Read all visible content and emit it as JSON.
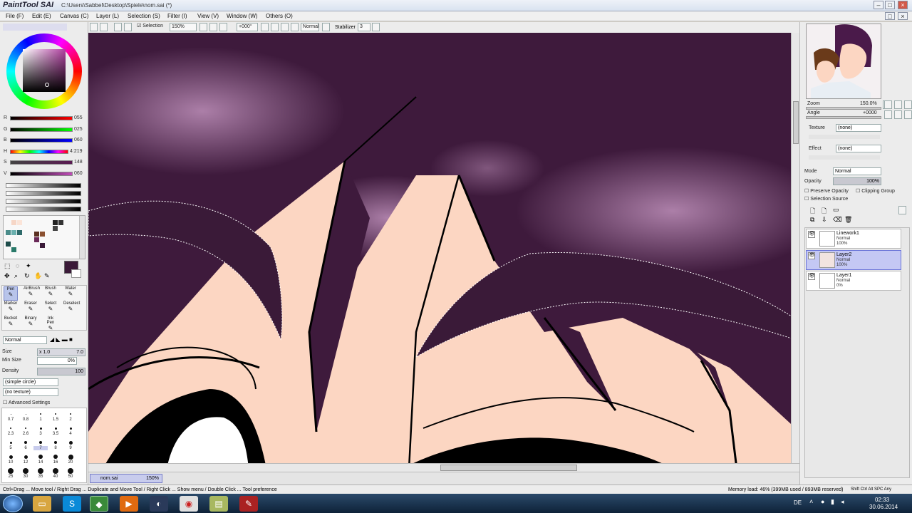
{
  "app": {
    "logo": "PaintTool SAI",
    "title_path": "C:\\Users\\Sabbel\\Desktop\\Spiele\\nom.sai (*)"
  },
  "menu": [
    "File (F)",
    "Edit (E)",
    "Canvas (C)",
    "Layer (L)",
    "Selection (S)",
    "Filter (I)",
    "View (V)",
    "Window (W)",
    "Others (O)"
  ],
  "toolbar": {
    "selection_label": "Selection",
    "zoom": "150%",
    "rotation": "+000°",
    "blend": "Normal",
    "stabilizer_label": "Stabilizer",
    "stabilizer_value": "3"
  },
  "color": {
    "current": "#3a1a38",
    "sliders": [
      {
        "label": "R",
        "value": "055"
      },
      {
        "label": "G",
        "value": "025"
      },
      {
        "label": "B",
        "value": "060"
      },
      {
        "label": "H",
        "value": "4:219"
      },
      {
        "label": "S",
        "value": "148"
      },
      {
        "label": "V",
        "value": "060"
      }
    ]
  },
  "tools": [
    {
      "label": "Pen",
      "selected": true
    },
    {
      "label": "AirBrush",
      "selected": false
    },
    {
      "label": "Brush",
      "selected": false
    },
    {
      "label": "Water",
      "selected": false
    },
    {
      "label": "Marker",
      "selected": false
    },
    {
      "label": "Eraser",
      "selected": false
    },
    {
      "label": "Select",
      "selected": false
    },
    {
      "label": "Deselect",
      "selected": false
    },
    {
      "label": "Bucket",
      "selected": false
    },
    {
      "label": "Binary",
      "selected": false
    },
    {
      "label": "Ink Pen",
      "selected": false
    }
  ],
  "brush": {
    "mode": "Normal",
    "size_label": "Size",
    "size_mult": "x 1.0",
    "size_value": "7.0",
    "minsize_label": "Min Size",
    "minsize_value": "0%",
    "density_label": "Density",
    "density_value": "100",
    "shape": "(simple circle)",
    "texture": "(no texture)",
    "advanced_label": "Advanced Settings",
    "sizes": [
      "0.7",
      "0.8",
      "1",
      "1.5",
      "2",
      "2.3",
      "2.6",
      "3",
      "3.5",
      "4",
      "5",
      "6",
      "7",
      "8",
      "9",
      "10",
      "12",
      "14",
      "16",
      "20",
      "25",
      "30",
      "35",
      "40",
      "50"
    ]
  },
  "navigator": {
    "zoom_label": "Zoom",
    "zoom_value": "150.0%",
    "angle_label": "Angle",
    "angle_value": "+0000"
  },
  "layer_props": {
    "texture_label": "Texture",
    "texture_value": "(none)",
    "effect_label": "Effect",
    "effect_value": "(none)",
    "mode_label": "Mode",
    "mode_value": "Normal",
    "opacity_label": "Opacity",
    "opacity_value": "100%",
    "preserve_opacity": "Preserve Opacity",
    "clipping_group": "Clipping Group",
    "selection_source": "Selection Source"
  },
  "layers": [
    {
      "name": "Linework1",
      "mode": "Normal",
      "opacity": "100%",
      "selected": false
    },
    {
      "name": "Layer2",
      "mode": "Normal",
      "opacity": "100%",
      "selected": true
    },
    {
      "name": "Layer1",
      "mode": "Normal",
      "opacity": "0%",
      "selected": false
    }
  ],
  "document_tab": {
    "name": "nom.sai",
    "zoom": "150%"
  },
  "status": {
    "hint": "Ctrl+Drag ... Move tool / Right Drag ... Duplicate and Move Tool / Right Click ... Show menu / Double Click ... Tool preference",
    "memory": "Memory load: 46% (399MB used / 893MB reserved)",
    "keys": "Shift Ctrl Alt SPC Any"
  },
  "taskbar": {
    "lang": "DE",
    "time": "02:33",
    "date": "30.06.2014"
  }
}
